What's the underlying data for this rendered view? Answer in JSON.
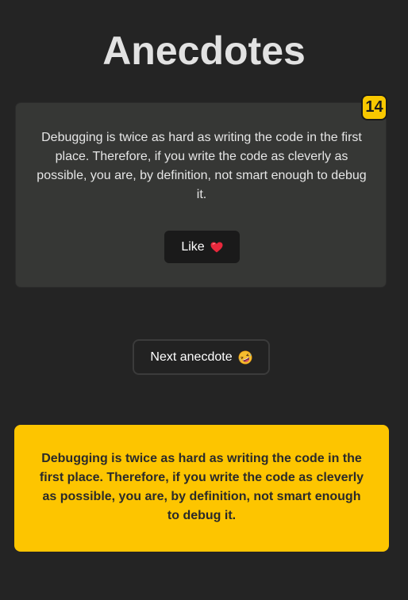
{
  "header": {
    "title": "Anecdotes"
  },
  "anecdote": {
    "text": "Debugging is twice as hard as writing the code in the first place. Therefore, if you write the code as cleverly as possible, you are, by definition, not smart enough to debug it.",
    "votes": "14",
    "like_label": "Like",
    "like_icon": "heart-icon"
  },
  "controls": {
    "next_label": "Next anecdote",
    "next_icon": "rolling-laughing-icon"
  },
  "top_anecdote": {
    "text": "Debugging is twice as hard as writing the code in the first place. Therefore, if you write the code as cleverly as possible, you are, by definition, not smart enough to debug it."
  },
  "colors": {
    "background": "#242424",
    "card": "#363735",
    "accent": "#fdc500",
    "badge": "#f8c800",
    "heart": "#e8283c"
  }
}
